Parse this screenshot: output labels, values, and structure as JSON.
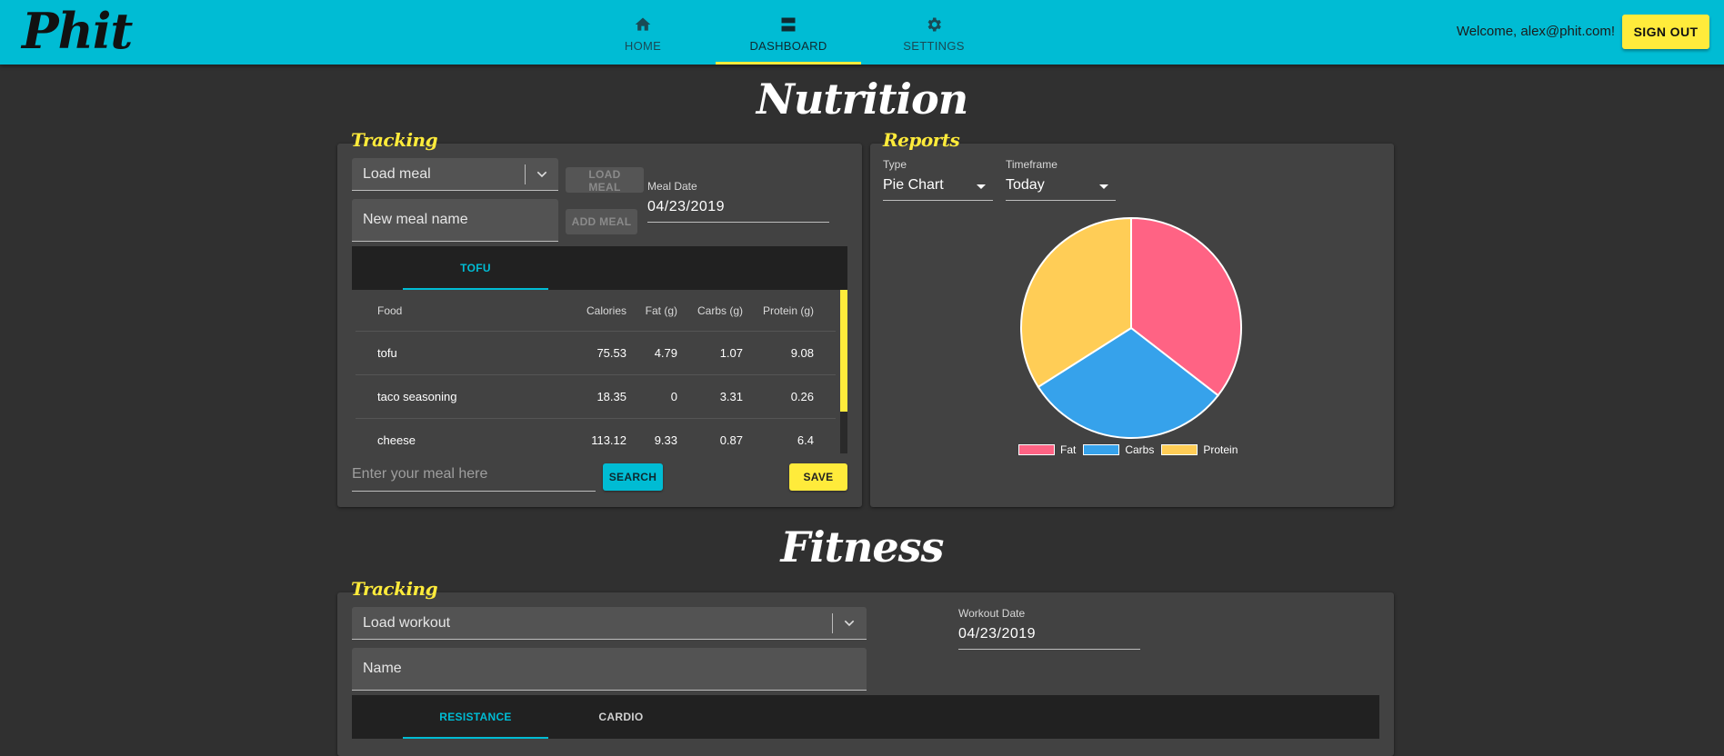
{
  "app": {
    "logo": "Phit"
  },
  "nav": {
    "items": [
      {
        "label": "HOME",
        "icon": "home-icon"
      },
      {
        "label": "DASHBOARD",
        "icon": "dashboard-icon",
        "active": true
      },
      {
        "label": "SETTINGS",
        "icon": "gear-icon"
      }
    ]
  },
  "header": {
    "welcome": "Welcome, alex@phit.com!",
    "signout": "SIGN OUT"
  },
  "nutrition": {
    "title": "Nutrition",
    "tracking": {
      "label": "Tracking",
      "load_meal_placeholder": "Load meal",
      "load_meal_button": "LOAD MEAL",
      "new_meal_placeholder": "New meal name",
      "add_meal_button": "ADD MEAL",
      "meal_date_label": "Meal Date",
      "meal_date": "04/23/2019",
      "tabs": [
        {
          "label": "TOFU",
          "active": true
        }
      ],
      "table": {
        "headers": [
          "Food",
          "Calories",
          "Fat (g)",
          "Carbs (g)",
          "Protein (g)"
        ],
        "rows": [
          [
            "tofu",
            "75.53",
            "4.79",
            "1.07",
            "9.08"
          ],
          [
            "taco seasoning",
            "18.35",
            "0",
            "3.31",
            "0.26"
          ],
          [
            "cheese",
            "113.12",
            "9.33",
            "0.87",
            "6.4"
          ]
        ]
      },
      "meal_input_placeholder": "Enter your meal here",
      "search_button": "SEARCH",
      "save_button": "SAVE"
    },
    "reports": {
      "label": "Reports",
      "type_label": "Type",
      "type_value": "Pie Chart",
      "timeframe_label": "Timeframe",
      "timeframe_value": "Today"
    }
  },
  "chart_data": {
    "type": "pie",
    "categories": [
      "Fat",
      "Carbs",
      "Protein"
    ],
    "values": [
      35.5,
      30.5,
      34.0
    ],
    "colors": [
      "#ff6384",
      "#36a2eb",
      "#ffcd56"
    ],
    "legend": "bottom"
  },
  "fitness": {
    "title": "Fitness",
    "tracking": {
      "label": "Tracking",
      "load_workout_placeholder": "Load workout",
      "name_placeholder": "Name",
      "workout_date_label": "Workout Date",
      "workout_date": "04/23/2019",
      "tabs": [
        {
          "label": "RESISTANCE",
          "active": true
        },
        {
          "label": "CARDIO"
        }
      ]
    }
  },
  "colors": {
    "accent": "#00bcd4",
    "highlight": "#ffeb3b",
    "background": "#303030",
    "card": "#424242"
  }
}
